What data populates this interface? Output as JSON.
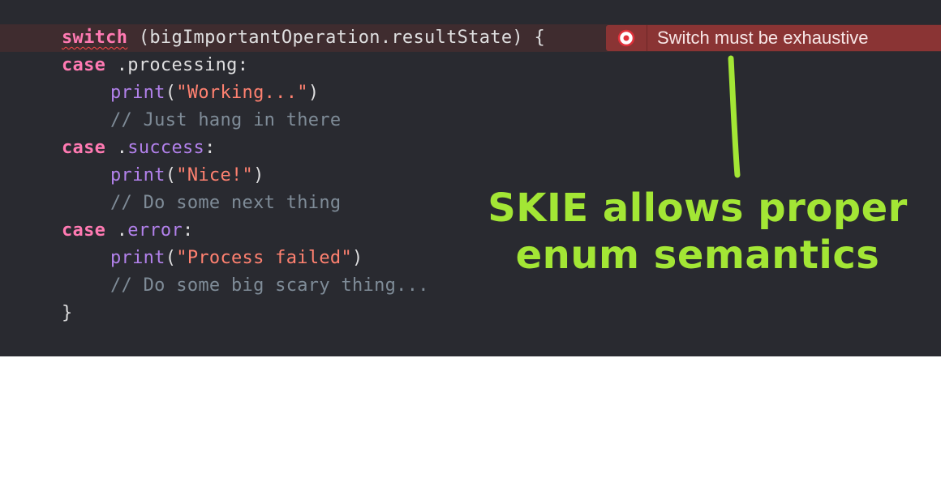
{
  "code": {
    "line1": {
      "keyword": "switch",
      "rest": " (bigImportantOperation.resultState) {"
    },
    "line2": {
      "keyword": "case",
      "dot": " .",
      "member": "processing",
      "colon": ":"
    },
    "line3": {
      "fn": "print",
      "open": "(",
      "str": "\"Working...\"",
      "close": ")"
    },
    "line4": {
      "comment": "// Just hang in there"
    },
    "line5": {
      "keyword": "case",
      "dot": " .",
      "member": "success",
      "colon": ":"
    },
    "line6": {
      "fn": "print",
      "open": "(",
      "str": "\"Nice!\"",
      "close": ")"
    },
    "line7": {
      "comment": "// Do some next thing"
    },
    "line8": {
      "keyword": "case",
      "dot": " .",
      "member": "error",
      "colon": ":"
    },
    "line9": {
      "fn": "print",
      "open": "(",
      "str": "\"Process failed\"",
      "close": ")"
    },
    "line10": {
      "comment": "// Do some big scary thing..."
    },
    "line11": {
      "brace": "}"
    }
  },
  "error": {
    "icon": "error-circle-icon",
    "message": "Switch must be exhaustive"
  },
  "callout": {
    "line1": "SKIE allows proper",
    "line2": "enum semantics"
  },
  "colors": {
    "editor_bg": "#292a30",
    "keyword": "#ff7ab2",
    "member": "#b281eb",
    "string": "#ff8170",
    "comment": "#7f8c98",
    "error_badge": "#8a3434",
    "callout": "#a3e635"
  }
}
